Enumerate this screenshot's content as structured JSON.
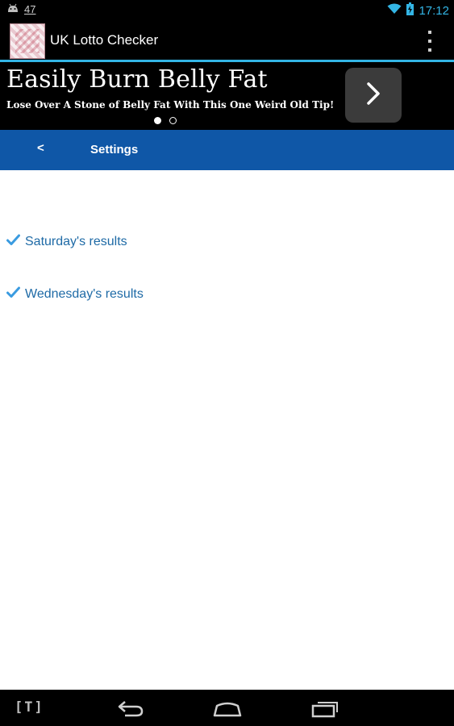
{
  "status_bar": {
    "notification_count": "47",
    "time": "17:12"
  },
  "action_bar": {
    "app_title": "UK Lotto Checker"
  },
  "ad": {
    "headline": "Easily Burn Belly Fat",
    "subtext": "Lose Over A Stone of Belly Fat With This One Weird Old Tip!",
    "page_count": 2,
    "active_page": 1
  },
  "nav": {
    "back_label": "<",
    "title": "Settings"
  },
  "settings": {
    "items": [
      {
        "label": "Saturday's results",
        "checked": true
      },
      {
        "label": "Wednesday's results",
        "checked": true
      }
    ]
  },
  "bottom_bar": {
    "keyboard_label": "[T]"
  },
  "colors": {
    "accent": "#33b5e5",
    "nav_bar": "#0f57a7",
    "setting_text": "#1e6aa6",
    "check": "#3a9be0"
  }
}
